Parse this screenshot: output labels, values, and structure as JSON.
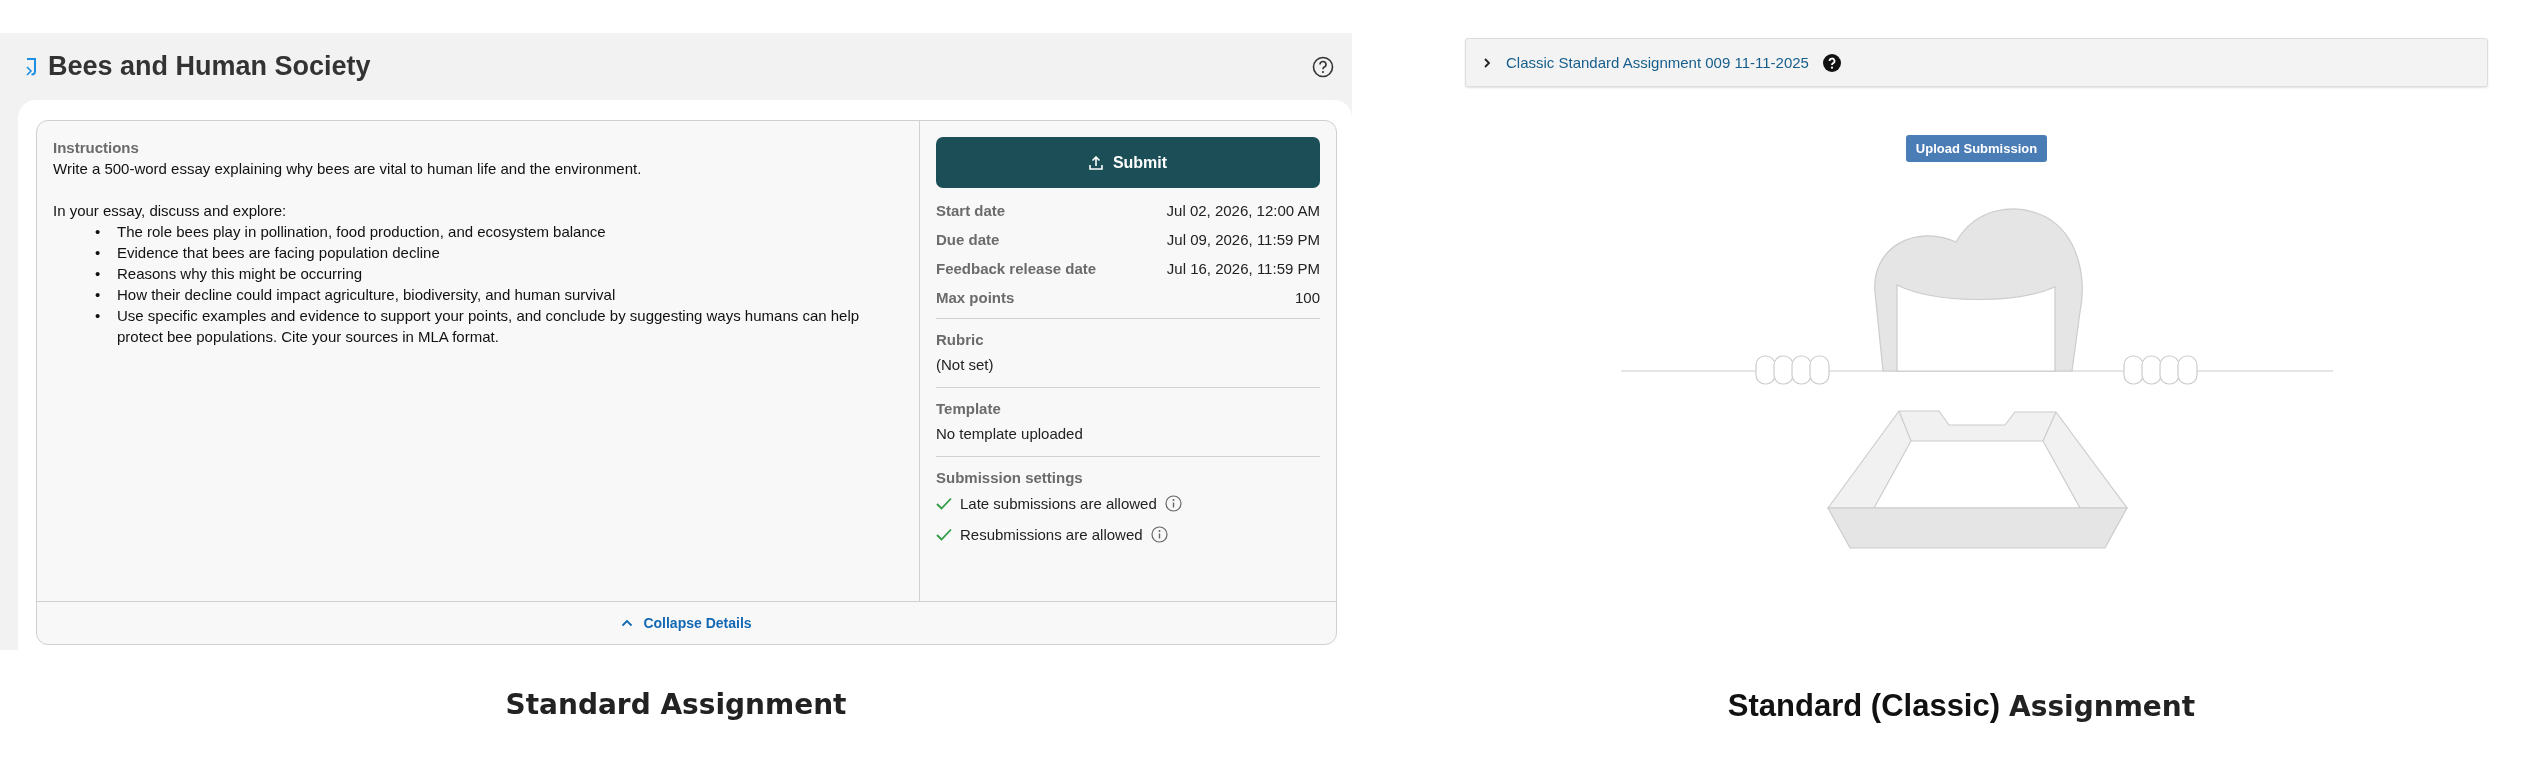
{
  "standard_assignment": {
    "title": "Bees and Human Society",
    "instructions": {
      "label": "Instructions",
      "intro": "Write a 500-word essay explaining why bees are vital to human life and the environment.",
      "lead": "In your essay, discuss and explore:",
      "bullets": [
        {
          "marker": "•",
          "text": "The role bees play in pollination, food production, and ecosystem balance"
        },
        {
          "marker": "•",
          "text": "Evidence that bees are facing population decline"
        },
        {
          "marker": "•",
          "text": "Reasons why this might be occurring"
        },
        {
          "marker": "•",
          "text": "How their decline could impact agriculture, biodiversity, and human survival"
        },
        {
          "marker": "•",
          "text": "Use specific examples and evidence to support your points, and conclude by suggesting ways humans can help protect bee populations. Cite your sources in MLA format."
        }
      ]
    },
    "submit_button": "Submit",
    "details": [
      {
        "label": "Start date",
        "value": "Jul 02, 2026, 12:00 AM"
      },
      {
        "label": "Due date",
        "value": "Jul 09, 2026, 11:59 PM"
      },
      {
        "label": "Feedback release date",
        "value": "Jul 16, 2026, 11:59 PM"
      },
      {
        "label": "Max points",
        "value": "100"
      }
    ],
    "rubric": {
      "label": "Rubric",
      "value": "(Not set)"
    },
    "template": {
      "label": "Template",
      "value": "No template uploaded"
    },
    "submission_settings": {
      "label": "Submission settings",
      "items": [
        {
          "text": "Late submissions are allowed",
          "checked": true
        },
        {
          "text": "Resubmissions are allowed",
          "checked": true
        }
      ]
    },
    "collapse_link": "Collapse Details"
  },
  "classic_assignment": {
    "header": {
      "title": "Classic Standard Assignment 009 11-11-2025",
      "expanded": false
    },
    "upload_button": "Upload Submission"
  },
  "captions": {
    "standard": "Standard Assignment",
    "classic_emphasis": "Standard (Classic)",
    "classic_rest": "Assignment"
  }
}
